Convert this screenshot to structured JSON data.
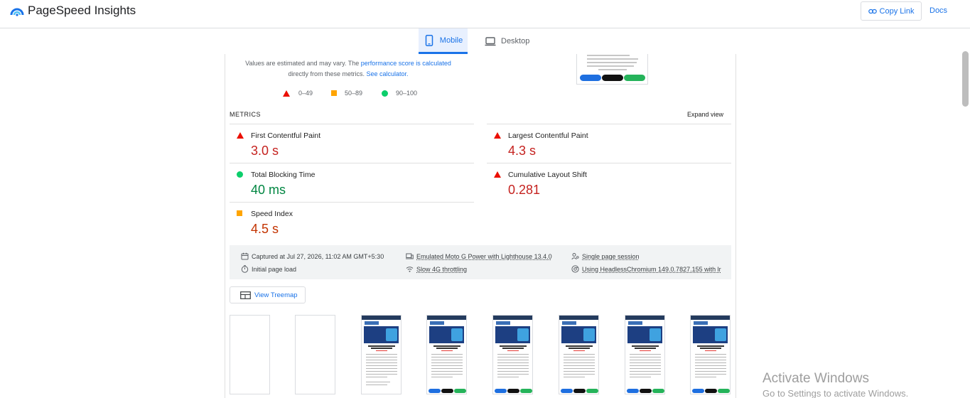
{
  "header": {
    "app_title": "PageSpeed Insights",
    "copy_link_label": "Copy Link",
    "docs_label": "Docs",
    "logo_icon": "pagespeed-logo-icon",
    "accent_color": "#1a73e8"
  },
  "tabs": [
    {
      "label": "Mobile",
      "icon": "smartphone-icon",
      "selected": true
    },
    {
      "label": "Desktop",
      "icon": "laptop-icon",
      "selected": false
    }
  ],
  "summary": {
    "line1_prefix": "Values are estimated and may vary. The ",
    "line1_link": "performance score is calculated",
    "line2_prefix": "directly from these metrics. ",
    "line2_link": "See calculator."
  },
  "legend": [
    {
      "range": "0–49",
      "shape": "triangle",
      "color": "#eb0f00"
    },
    {
      "range": "50–89",
      "shape": "square",
      "color": "#ffa400"
    },
    {
      "range": "90–100",
      "shape": "circle",
      "color": "#0cce6b"
    }
  ],
  "metrics": {
    "title": "METRICS",
    "expand_label": "Expand view",
    "items": [
      {
        "name": "First Contentful Paint",
        "value": "3.0 s",
        "status": "poor"
      },
      {
        "name": "Largest Contentful Paint",
        "value": "4.3 s",
        "status": "poor"
      },
      {
        "name": "Total Blocking Time",
        "value": "40 ms",
        "status": "good"
      },
      {
        "name": "Cumulative Layout Shift",
        "value": "0.281",
        "status": "poor"
      },
      {
        "name": "Speed Index",
        "value": "4.5 s",
        "status": "average"
      }
    ]
  },
  "run_info": {
    "captured": "Captured at Jul 27, 2026, 11:02 AM GMT+5:30",
    "load_type": "Initial page load",
    "device": "Emulated Moto G Power with Lighthouse 13.4.0",
    "throttling": "Slow 4G throttling",
    "session": "Single page session",
    "browser": "Using HeadlessChromium 149.0.7827.155 with lr"
  },
  "treemap_label": "View Treemap",
  "filmstrip": {
    "frames": 8,
    "blank_frames": 2
  },
  "watermark": {
    "line1": "Activate Windows",
    "line2": "Go to Settings to activate Windows."
  }
}
